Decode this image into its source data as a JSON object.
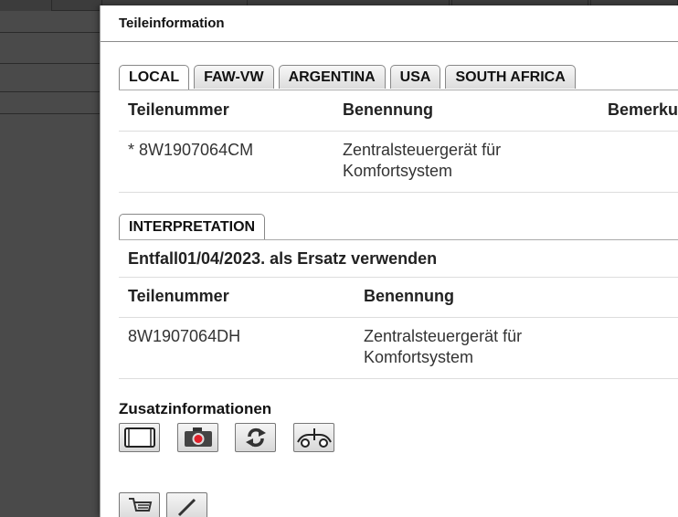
{
  "dialog": {
    "title": "Teileinformation"
  },
  "tabs": [
    {
      "label": "LOCAL"
    },
    {
      "label": "FAW-VW"
    },
    {
      "label": "ARGENTINA"
    },
    {
      "label": "USA"
    },
    {
      "label": "SOUTH AFRICA"
    }
  ],
  "local_table": {
    "headers": [
      "Teilenummer",
      "Benennung",
      "Bemerku"
    ],
    "row": {
      "part_number": "* 8W1907064CM",
      "name_line1": "Zentralsteuergerät für",
      "name_line2": "Komfortsystem"
    }
  },
  "interpretation": {
    "tab_label": "INTERPRETATION",
    "note": "Entfall01/04/2023. als Ersatz verwenden",
    "headers": [
      "Teilenummer",
      "Benennung"
    ],
    "row": {
      "part_number": "8W1907064DH",
      "name_line1": "Zentralsteuergerät für",
      "name_line2": "Komfortsystem"
    }
  },
  "additional": {
    "title": "Zusatzinformationen"
  },
  "toolbar_icons": [
    "frame-icon",
    "camera-icon",
    "refresh-icon",
    "vehicle-icon"
  ],
  "bottom_icons": [
    "cart-icon",
    "pencil-icon"
  ],
  "colors": {
    "camera_dot": "#e0202a"
  }
}
